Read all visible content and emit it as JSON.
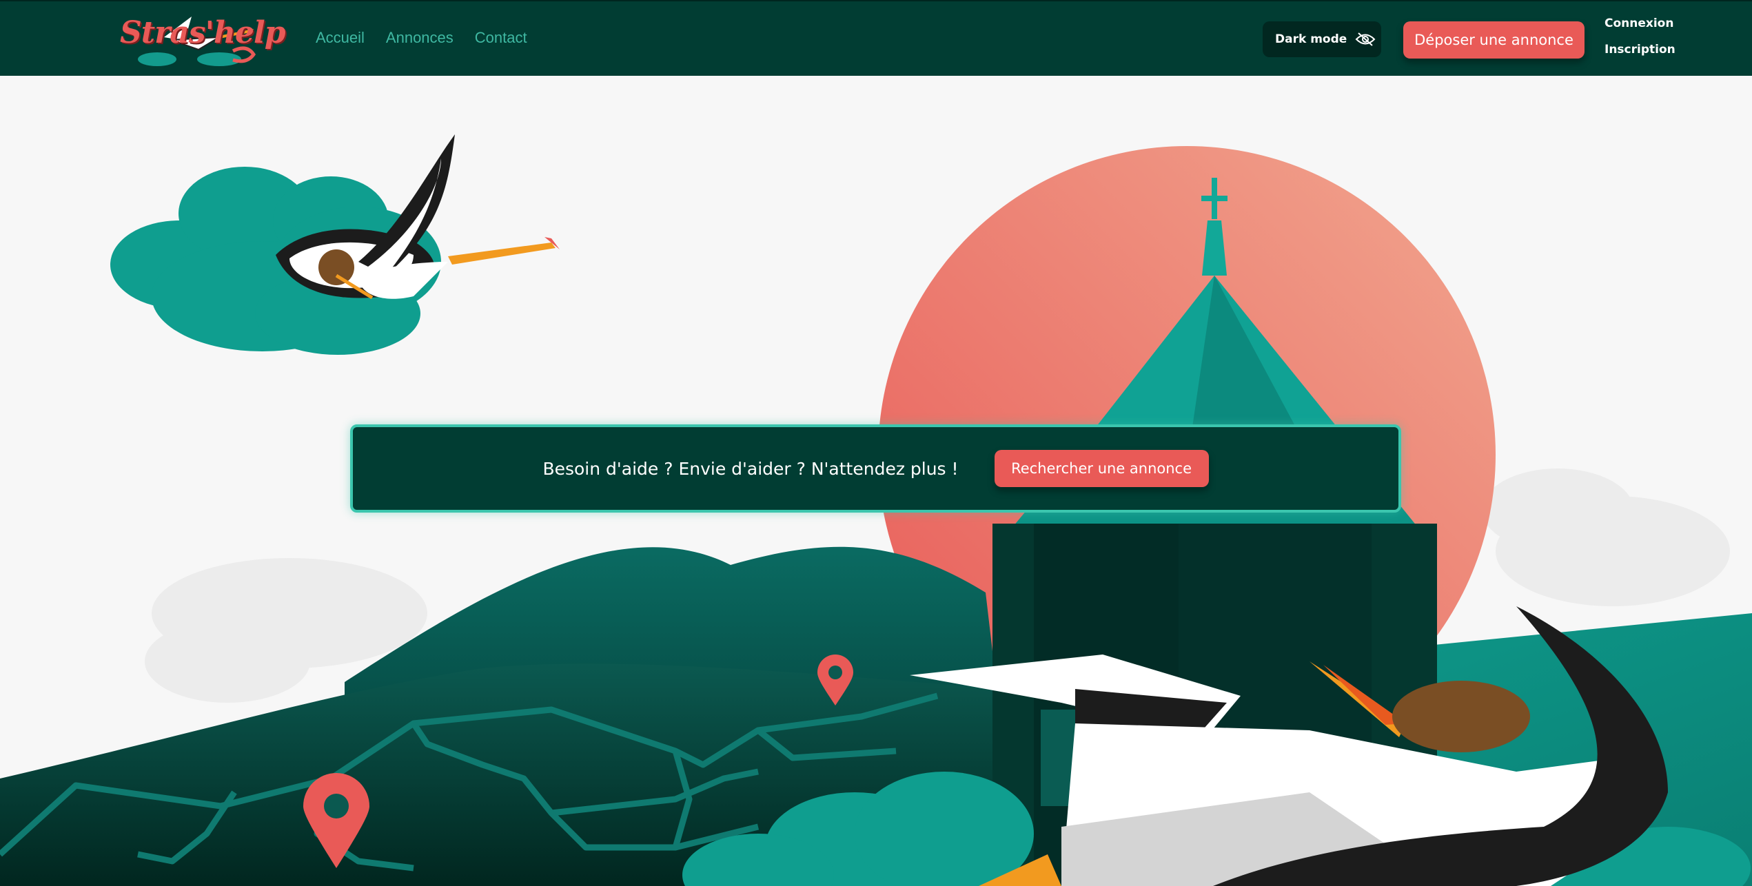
{
  "brand": {
    "name": "Stras'help"
  },
  "nav": {
    "links": [
      {
        "label": "Accueil"
      },
      {
        "label": "Annonces"
      },
      {
        "label": "Contact"
      }
    ],
    "dark_mode_label": "Dark mode",
    "deposit_label": "Déposer une annonce",
    "login_label": "Connexion",
    "register_label": "Inscription"
  },
  "hero": {
    "tagline": "Besoin d'aide ? Envie d'aider ? N'attendez plus !",
    "search_label": "Rechercher une annonce"
  },
  "colors": {
    "nav_bg": "#013d33",
    "accent": "#e95a57",
    "teal": "#3fb8a2",
    "sun_top": "#f1a68f",
    "sun_bottom": "#e85a57"
  },
  "icons": {
    "dark_mode": "eye-slash-icon",
    "map_pin": "map-pin-icon"
  }
}
